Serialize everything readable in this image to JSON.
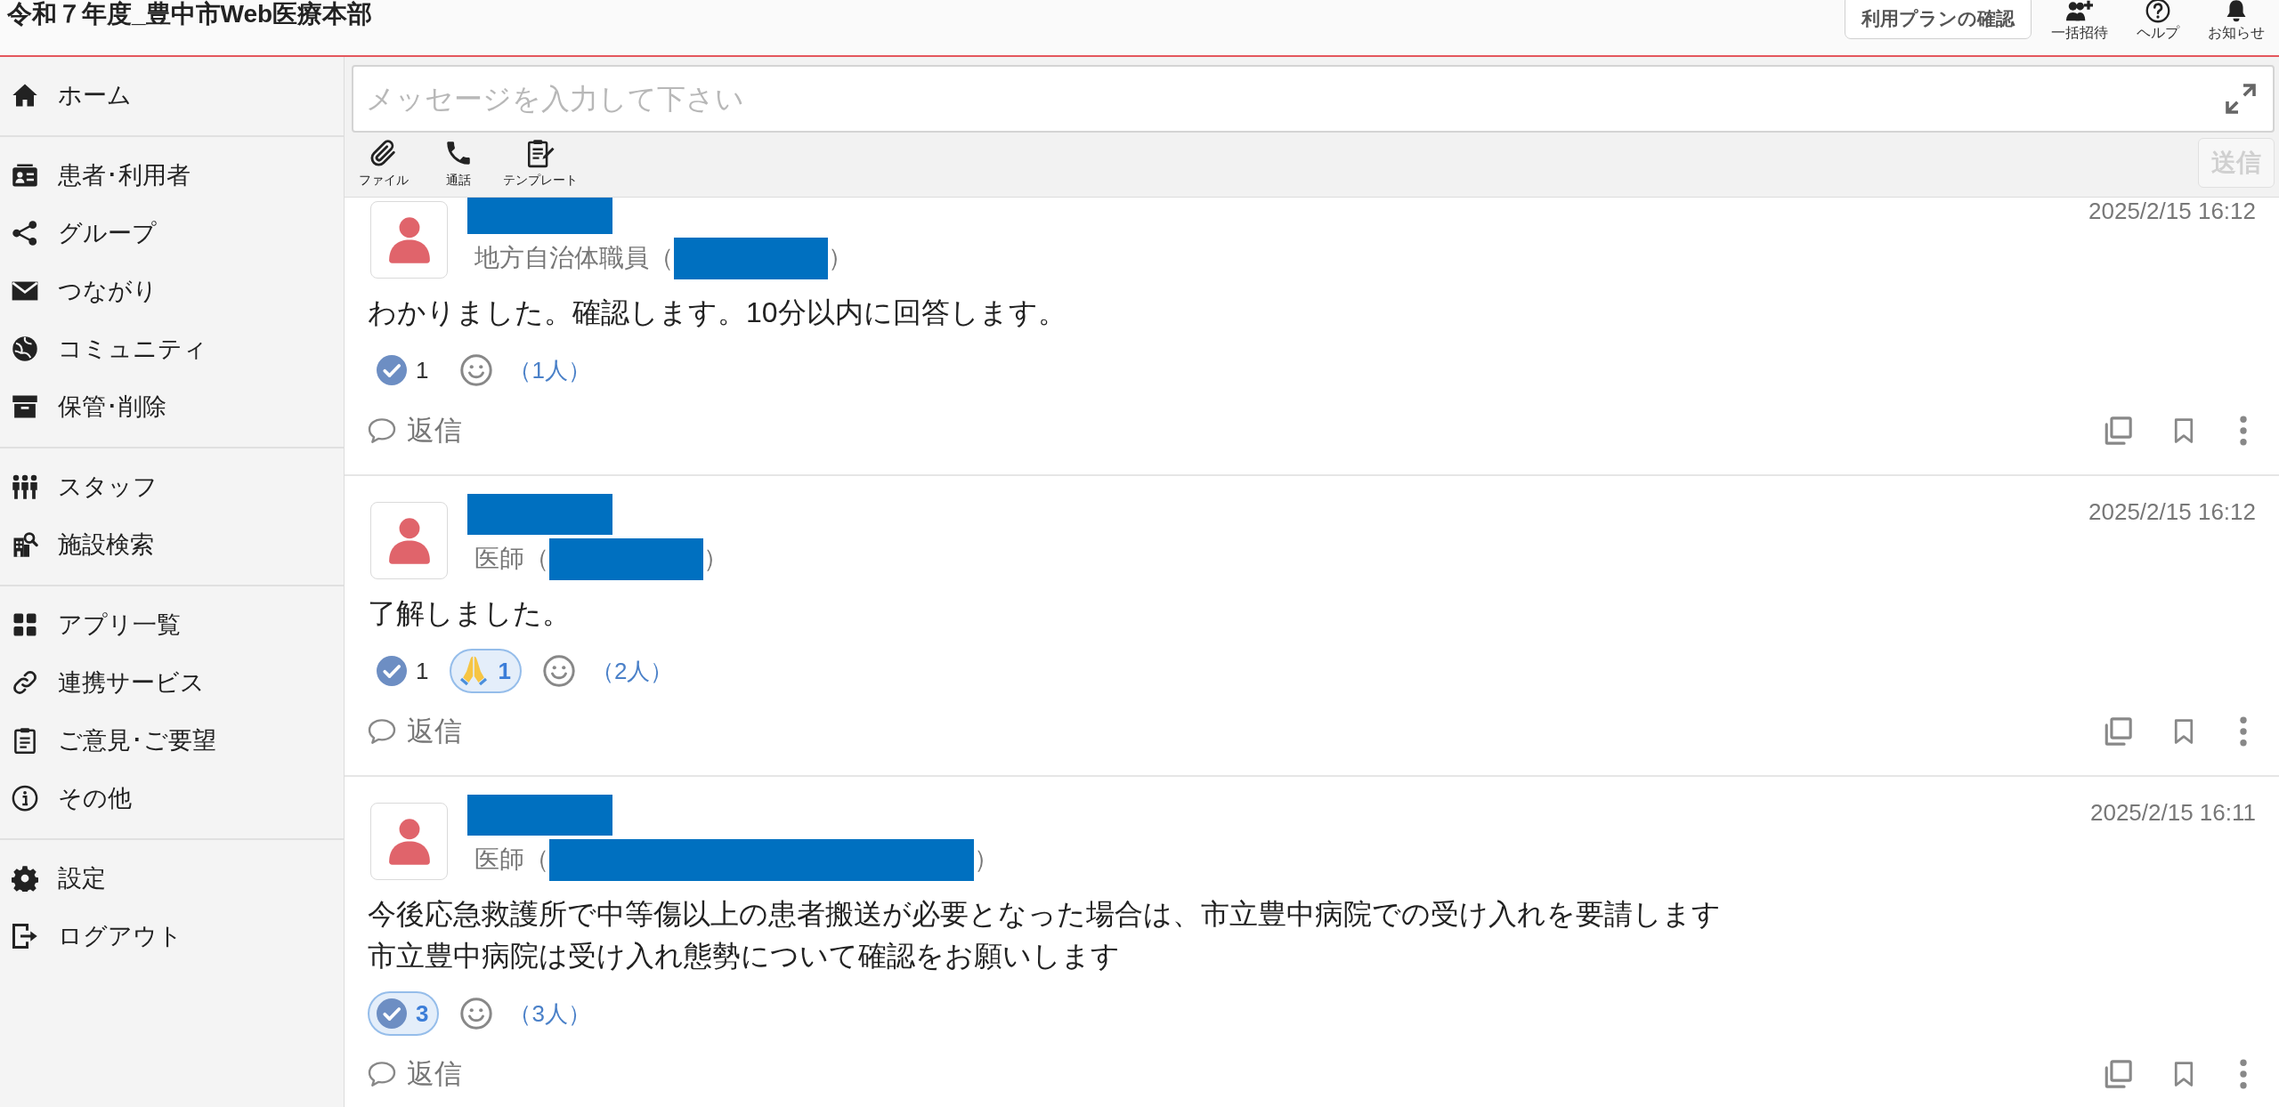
{
  "header": {
    "title": "令和７年度_豊中市Web医療本部",
    "plan_button": "利用プランの確認",
    "actions": [
      {
        "kind": "invite",
        "label": "一括招待"
      },
      {
        "kind": "help",
        "label": "ヘルプ"
      },
      {
        "kind": "notice",
        "label": "お知らせ"
      }
    ]
  },
  "sidebar": {
    "sections": [
      {
        "items": [
          {
            "kind": "home",
            "label": "ホーム",
            "selected": false
          }
        ]
      },
      {
        "items": [
          {
            "kind": "patients",
            "label": "患者･利用者",
            "selected": false
          },
          {
            "kind": "group",
            "label": "グループ",
            "selected": false
          },
          {
            "kind": "connections",
            "label": "つながり",
            "selected": false
          },
          {
            "kind": "community",
            "label": "コミュニティ",
            "selected": false
          },
          {
            "kind": "archive",
            "label": "保管･削除",
            "selected": false
          }
        ]
      },
      {
        "items": [
          {
            "kind": "staff",
            "label": "スタッフ",
            "selected": false
          },
          {
            "kind": "facilities",
            "label": "施設検索",
            "selected": false
          }
        ]
      },
      {
        "items": [
          {
            "kind": "apps",
            "label": "アプリ一覧",
            "selected": false
          },
          {
            "kind": "services",
            "label": "連携サービス",
            "selected": false
          },
          {
            "kind": "feedback",
            "label": "ご意見･ご要望",
            "selected": false
          },
          {
            "kind": "other",
            "label": "その他",
            "selected": false
          }
        ]
      },
      {
        "items": [
          {
            "kind": "settings",
            "label": "設定",
            "selected": false
          },
          {
            "kind": "logout",
            "label": "ログアウト",
            "selected": false
          }
        ]
      }
    ]
  },
  "composer": {
    "placeholder": "メッセージを入力して下さい",
    "tools": [
      {
        "kind": "file",
        "label": "ファイル"
      },
      {
        "kind": "call",
        "label": "通話"
      },
      {
        "kind": "template",
        "label": "テンプレート"
      }
    ],
    "send_button": {
      "label": "送信",
      "disabled": true
    }
  },
  "messages": [
    {
      "name_redacted": true,
      "role": "地方自治体職員（",
      "affiliation_redacted": true,
      "wide_redaction": false,
      "role_close": "）",
      "timestamp": "2025/2/15 16:12",
      "body_lines": [
        "わかりました。確認します。10分以内に回答します。"
      ],
      "reactions": [
        {
          "kind": "check",
          "count": "1",
          "selected": false
        }
      ],
      "reacted_users": "（1人）",
      "reply": "返信"
    },
    {
      "name_redacted": true,
      "role": "医師（",
      "affiliation_redacted": true,
      "wide_redaction": false,
      "role_close": "）",
      "timestamp": "2025/2/15 16:12",
      "body_lines": [
        "了解しました。"
      ],
      "reactions": [
        {
          "kind": "check",
          "count": "1",
          "selected": false
        },
        {
          "kind": "pray",
          "count": "1",
          "selected": true
        }
      ],
      "reacted_users": "（2人）",
      "reply": "返信"
    },
    {
      "name_redacted": true,
      "role": "医師（",
      "affiliation_redacted": true,
      "wide_redaction": true,
      "role_close": "）",
      "timestamp": "2025/2/15 16:11",
      "body_lines": [
        "今後応急救護所で中等傷以上の患者搬送が必要となった場合は、市立豊中病院での受け入れを要請します",
        "市立豊中病院は受け入れ態勢について確認をお願いします"
      ],
      "reactions": [
        {
          "kind": "check",
          "count": "3",
          "selected": true
        }
      ],
      "reacted_users": "（3人）",
      "reply": "返信"
    }
  ]
}
